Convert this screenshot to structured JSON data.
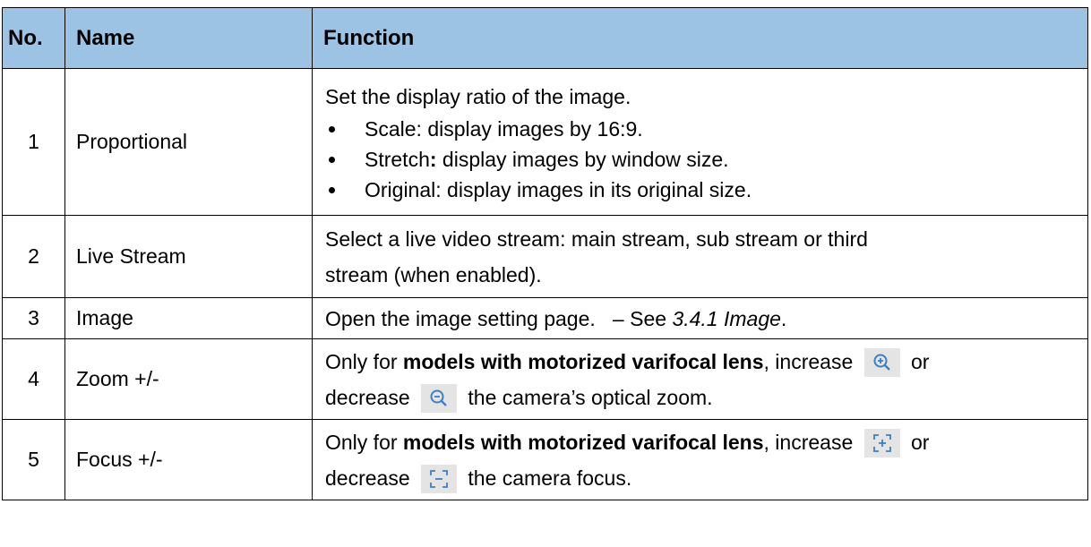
{
  "caption": "",
  "headers": {
    "no": "No.",
    "name": "Name",
    "function": "Function"
  },
  "rows": [
    {
      "no": "1",
      "name": "Proportional",
      "intro": "Set the display ratio of the image.",
      "bullets": [
        {
          "term": "Scale",
          "sep": ":",
          "text": " display images by 16:9."
        },
        {
          "term": "Stretch",
          "sep": ":",
          "text": " display images by window size."
        },
        {
          "term": "Original",
          "sep": ":",
          "text": " display images in its original size."
        }
      ]
    },
    {
      "no": "2",
      "name": "Live Stream",
      "line1": "Select a live video stream: main stream, sub stream or third",
      "line2": "stream (when enabled)."
    },
    {
      "no": "3",
      "name": "Image",
      "pre": "Open the image setting page.   – See ",
      "ref": "3.4.1 Image",
      "post": "."
    },
    {
      "no": "4",
      "name": "Zoom +/-",
      "l1_pre": "Only for ",
      "l1_bold": "models with motorized varifocal lens",
      "l1_mid": ", increase ",
      "l1_post": " or",
      "l2_pre": "decrease ",
      "l2_post": " the camera’s optical zoom.",
      "icon_increase": "zoom-in-icon",
      "icon_decrease": "zoom-out-icon"
    },
    {
      "no": "5",
      "name": "Focus +/-",
      "l1_pre": "Only for ",
      "l1_bold": "models with motorized varifocal lens",
      "l1_mid": ", increase ",
      "l1_post": " or",
      "l2_pre": "decrease ",
      "l2_post": " the camera focus.",
      "icon_increase": "focus-near-icon",
      "icon_decrease": "focus-far-icon"
    }
  ],
  "colors": {
    "header_bg": "#9cc2e4",
    "icon_bg": "#e4e4e4",
    "icon_fg": "#3d7fc4"
  }
}
